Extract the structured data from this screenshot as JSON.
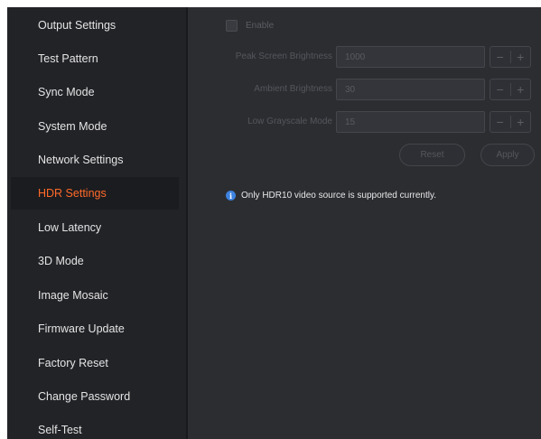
{
  "sidebar": {
    "items": [
      {
        "label": "Output Settings",
        "active": false
      },
      {
        "label": "Test Pattern",
        "active": false
      },
      {
        "label": "Sync Mode",
        "active": false
      },
      {
        "label": "System Mode",
        "active": false
      },
      {
        "label": "Network Settings",
        "active": false
      },
      {
        "label": "HDR Settings",
        "active": true
      },
      {
        "label": "Low Latency",
        "active": false
      },
      {
        "label": "3D Mode",
        "active": false
      },
      {
        "label": "Image Mosaic",
        "active": false
      },
      {
        "label": "Firmware Update",
        "active": false
      },
      {
        "label": "Factory Reset",
        "active": false
      },
      {
        "label": "Change Password",
        "active": false
      },
      {
        "label": "Self-Test",
        "active": false
      }
    ]
  },
  "hdr": {
    "enable_label": "Enable",
    "enable_checked": false,
    "fields": [
      {
        "label": "Peak Screen Brightness",
        "value": "1000"
      },
      {
        "label": "Ambient Brightness",
        "value": "30"
      },
      {
        "label": "Low Grayscale Mode",
        "value": "15"
      }
    ],
    "stepper_minus": "−",
    "stepper_plus": "+",
    "reset_label": "Reset",
    "apply_label": "Apply",
    "info_icon_glyph": "i",
    "info_text": "Only HDR10 video source is supported currently."
  },
  "colors": {
    "sidebar_bg": "#222327",
    "main_bg": "#2c2d31",
    "active_text": "#ff6a2a",
    "info_icon": "#3d82e0"
  }
}
